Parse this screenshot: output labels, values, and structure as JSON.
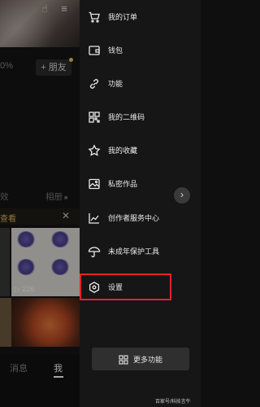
{
  "background_app": {
    "stats_partial": "0%",
    "add_friend_label": "+ 朋友",
    "tab_partial": "效",
    "album_label": "相册",
    "banner_text": "查看",
    "banner_close": "✕",
    "play_count": "▷ 226",
    "bottom_messages": "消息",
    "bottom_me": "我"
  },
  "drawer": {
    "menu_items": [
      {
        "label": "我的订单",
        "icon": "shopping-cart-icon"
      },
      {
        "label": "钱包",
        "icon": "wallet-icon"
      },
      {
        "label": "功能",
        "icon": "link-icon"
      },
      {
        "label": "我的二维码",
        "icon": "qr-code-icon"
      },
      {
        "label": "我的收藏",
        "icon": "star-icon"
      },
      {
        "label": "私密作品",
        "icon": "private-image-icon"
      },
      {
        "label": "创作者服务中心",
        "icon": "chart-icon"
      },
      {
        "label": "未成年保护工具",
        "icon": "umbrella-icon"
      },
      {
        "label": "设置",
        "icon": "settings-hexagon-icon"
      }
    ],
    "more_button_label": "更多功能",
    "side_arrow": "›"
  },
  "watermark": "百家号/科技言午",
  "colors": {
    "drawer_bg": "#161616",
    "highlight_border": "#e3232a",
    "banner_text": "#e0b75a"
  }
}
